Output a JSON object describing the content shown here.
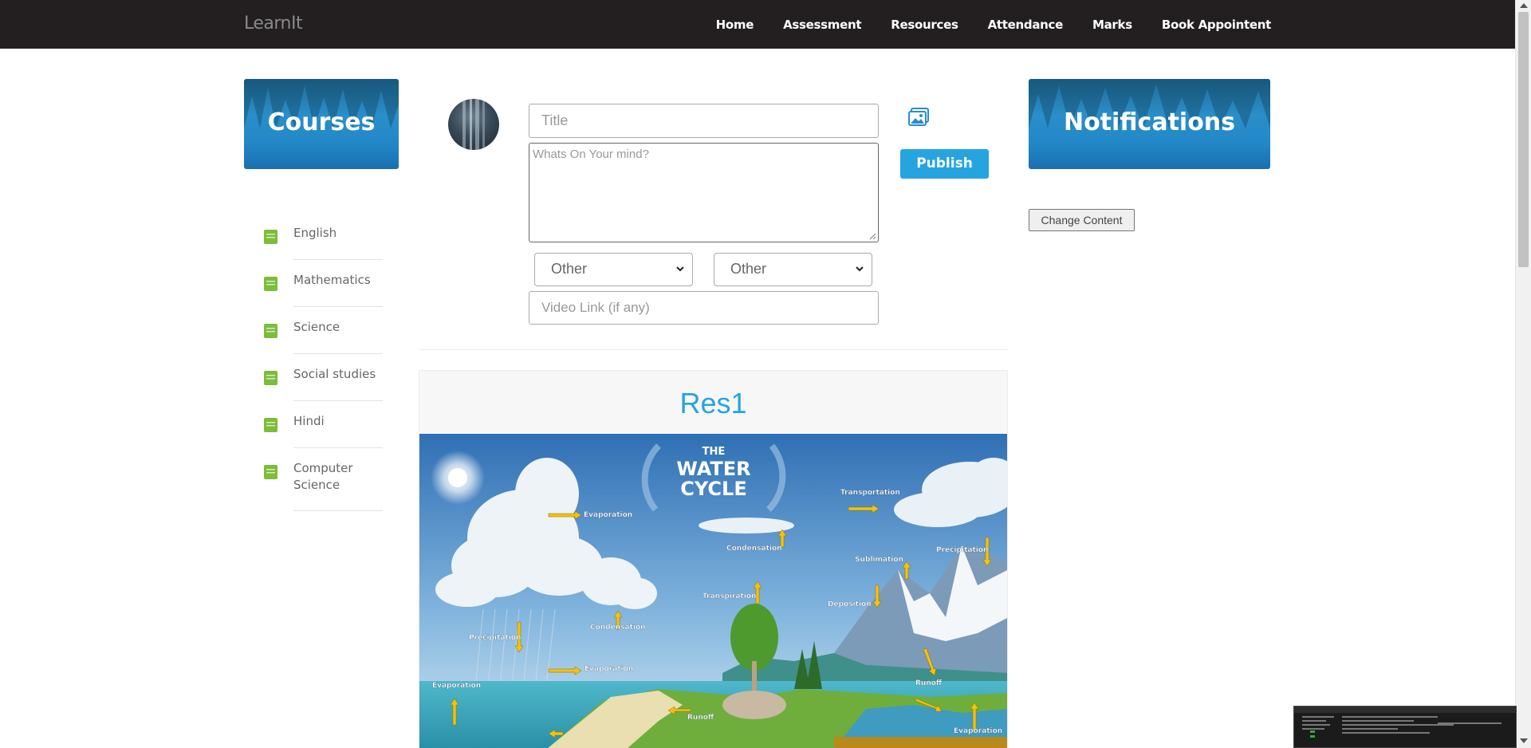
{
  "navbar": {
    "brand": "LearnIt",
    "links": [
      "Home",
      "Assessment",
      "Resources",
      "Attendance",
      "Marks",
      "Book Appointent"
    ]
  },
  "courses": {
    "title": "Courses",
    "items": [
      "English",
      "Mathematics",
      "Science",
      "Social studies",
      "Hindi",
      "Computer Science"
    ]
  },
  "post_form": {
    "title_placeholder": "Title",
    "mind_placeholder": "Whats On Your mind?",
    "select1_value": "Other",
    "select2_value": "Other",
    "video_placeholder": "Video Link (if any)",
    "publish_label": "Publish"
  },
  "resource": {
    "title": "Res1",
    "image_labels": {
      "header_the": "THE",
      "header_water": "WATER",
      "header_cycle": "CYCLE",
      "evaporation_1": "Evaporation",
      "transportation": "Transportation",
      "condensation_1": "Condensation",
      "sublimation": "Sublimation",
      "precipitation_1": "Precipitation",
      "transpiration": "Transpiration",
      "deposition": "Deposition",
      "condensation_2": "Condensation",
      "precipitation_2": "Precipitation",
      "evaporation_2": "Evaporation",
      "evaporation_3": "Evaporation",
      "runoff_1": "Runoff",
      "runoff_2": "Runoff",
      "evaporation_4": "Evaporation"
    }
  },
  "notifications": {
    "title": "Notifications",
    "change_content_label": "Change Content"
  },
  "colors": {
    "navbar_bg": "#231f20",
    "accent": "#26a4e0",
    "course_icon": "#7cbd3a"
  }
}
